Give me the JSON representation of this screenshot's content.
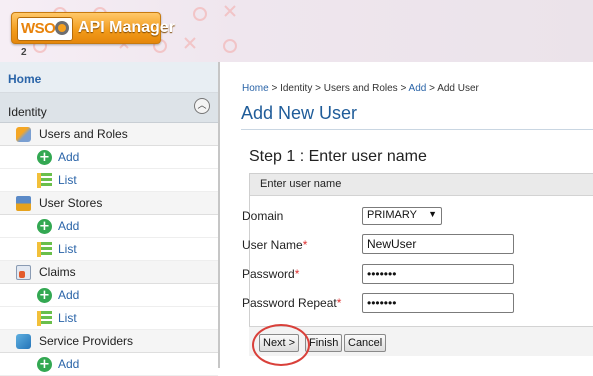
{
  "header": {
    "logo": {
      "brand": "WSO",
      "sub": "2",
      "product": "API Manager"
    }
  },
  "sidebar": {
    "home": "Home",
    "section": "Identity",
    "items": [
      {
        "label": "Users and Roles",
        "icon": "users-roles-icon",
        "level": 1
      },
      {
        "label": "Add",
        "icon": "add-icon",
        "level": 2
      },
      {
        "label": "List",
        "icon": "list-icon",
        "level": 2
      },
      {
        "label": "User Stores",
        "icon": "user-stores-icon",
        "level": 1
      },
      {
        "label": "Add",
        "icon": "add-icon",
        "level": 2
      },
      {
        "label": "List",
        "icon": "list-icon",
        "level": 2
      },
      {
        "label": "Claims",
        "icon": "claims-icon",
        "level": 1
      },
      {
        "label": "Add",
        "icon": "add-icon",
        "level": 2
      },
      {
        "label": "List",
        "icon": "list-icon",
        "level": 2
      },
      {
        "label": "Service Providers",
        "icon": "service-providers-icon",
        "level": 1
      },
      {
        "label": "Add",
        "icon": "add-icon",
        "level": 2
      }
    ]
  },
  "main": {
    "breadcrumb": {
      "parts": [
        "Home",
        "Identity",
        "Users and Roles",
        "Add",
        "Add User"
      ],
      "sep": " > "
    },
    "title": "Add New User",
    "step_title": "Step 1 : Enter user name",
    "panel_title": "Enter user name",
    "form": {
      "domain_label": "Domain",
      "domain_value": "PRIMARY",
      "username_label": "User Name",
      "username_value": "NewUser",
      "password_label": "Password",
      "password_value": "•••••••",
      "password_repeat_label": "Password Repeat",
      "password_repeat_value": "•••••••",
      "required_mark": "*"
    },
    "buttons": {
      "next": "Next >",
      "finish": "Finish",
      "cancel": "Cancel"
    }
  },
  "colors": {
    "link": "#2a64a8",
    "title": "#1f5c99",
    "required": "#e03030",
    "highlight": "#d9403a"
  }
}
